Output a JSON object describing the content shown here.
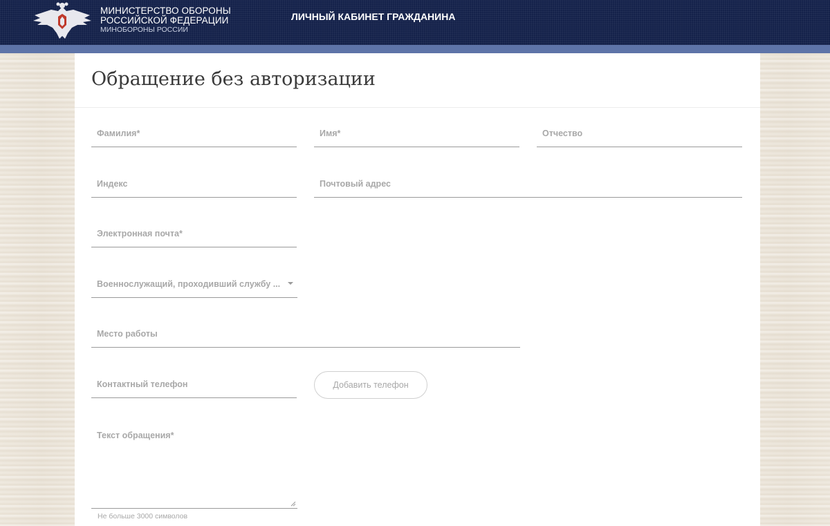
{
  "header": {
    "org_line1": "МИНИСТЕРСТВО ОБОРОНЫ",
    "org_line2": "РОССИЙСКОЙ ФЕДЕРАЦИИ",
    "org_line3": "МИНОБОРОНЫ РОССИИ",
    "cabinet_title": "ЛИЧНЫЙ КАБИНЕТ ГРАЖДАНИНА",
    "logo_icon": "double-headed-eagle-emblem-icon"
  },
  "page": {
    "title": "Обращение без авторизации"
  },
  "form": {
    "surname_label": "Фамилия*",
    "name_label": "Имя*",
    "patronymic_label": "Отчество",
    "index_label": "Индекс",
    "address_label": "Почтовый адрес",
    "email_label": "Электронная почта*",
    "category_label": "Военнослужащий, проходивший службу ...",
    "workplace_label": "Место работы",
    "phone_label": "Контактный телефон",
    "add_phone_label": "Добавить телефон",
    "message_label": "Текст обращения*",
    "message_hint": "Не больше 3000 символов"
  },
  "colors": {
    "header_bg": "#14214a",
    "stripe": "#5e74a8",
    "label": "#a8a8a8"
  }
}
